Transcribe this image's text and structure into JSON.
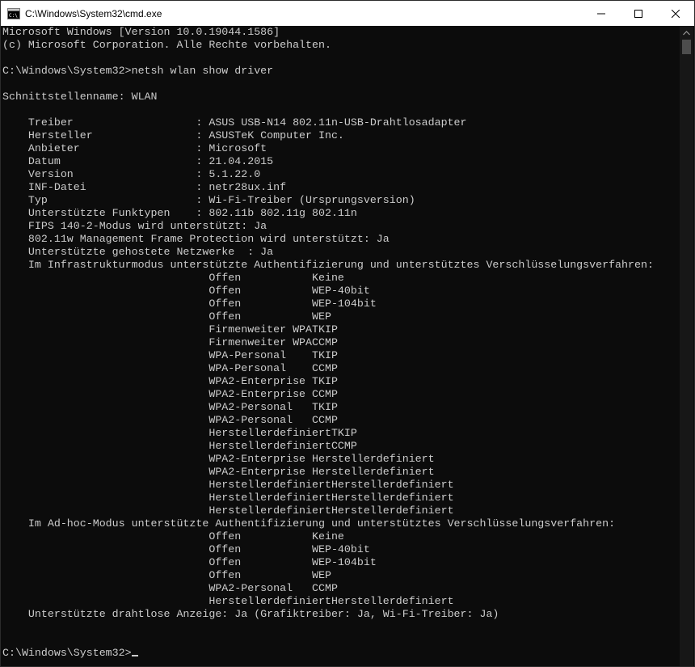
{
  "window": {
    "title": "C:\\Windows\\System32\\cmd.exe"
  },
  "icons": {
    "app": "cmd-icon",
    "minimize": "minimize-icon",
    "maximize": "maximize-icon",
    "close": "close-icon",
    "scroll_up": "scroll-up-icon"
  },
  "colors": {
    "background": "#0c0c0c",
    "text": "#cccccc",
    "titlebar": "#ffffff"
  },
  "console": {
    "prompt_final": "C:\\Windows\\System32>",
    "lines": [
      "Microsoft Windows [Version 10.0.19044.1586]",
      "(c) Microsoft Corporation. Alle Rechte vorbehalten.",
      "",
      "C:\\Windows\\System32>netsh wlan show driver",
      "",
      "Schnittstellenname: WLAN",
      "",
      "    Treiber                   : ASUS USB-N14 802.11n-USB-Drahtlosadapter",
      "    Hersteller                : ASUSTeK Computer Inc.",
      "    Anbieter                  : Microsoft",
      "    Datum                     : 21.04.2015",
      "    Version                   : 5.1.22.0",
      "    INF-Datei                 : netr28ux.inf",
      "    Typ                       : Wi-Fi-Treiber (Ursprungsversion)",
      "    Unterstützte Funktypen    : 802.11b 802.11g 802.11n",
      "    FIPS 140-2-Modus wird unterstützt: Ja",
      "    802.11w Management Frame Protection wird unterstützt: Ja",
      "    Unterstützte gehostete Netzwerke  : Ja",
      "    Im Infrastrukturmodus unterstützte Authentifizierung und unterstütztes Verschlüsselungsverfahren:",
      "                                Offen           Keine",
      "                                Offen           WEP-40bit",
      "                                Offen           WEP-104bit",
      "                                Offen           WEP",
      "                                Firmenweiter WPATKIP",
      "                                Firmenweiter WPACCMP",
      "                                WPA-Personal    TKIP",
      "                                WPA-Personal    CCMP",
      "                                WPA2-Enterprise TKIP",
      "                                WPA2-Enterprise CCMP",
      "                                WPA2-Personal   TKIP",
      "                                WPA2-Personal   CCMP",
      "                                HerstellerdefiniertTKIP",
      "                                HerstellerdefiniertCCMP",
      "                                WPA2-Enterprise Herstellerdefiniert",
      "                                WPA2-Enterprise Herstellerdefiniert",
      "                                HerstellerdefiniertHerstellerdefiniert",
      "                                HerstellerdefiniertHerstellerdefiniert",
      "                                HerstellerdefiniertHerstellerdefiniert",
      "    Im Ad-hoc-Modus unterstützte Authentifizierung und unterstütztes Verschlüsselungsverfahren:",
      "                                Offen           Keine",
      "                                Offen           WEP-40bit",
      "                                Offen           WEP-104bit",
      "                                Offen           WEP",
      "                                WPA2-Personal   CCMP",
      "                                HerstellerdefiniertHerstellerdefiniert",
      "    Unterstützte drahtlose Anzeige: Ja (Grafiktreiber: Ja, Wi-Fi-Treiber: Ja)",
      "",
      ""
    ]
  }
}
